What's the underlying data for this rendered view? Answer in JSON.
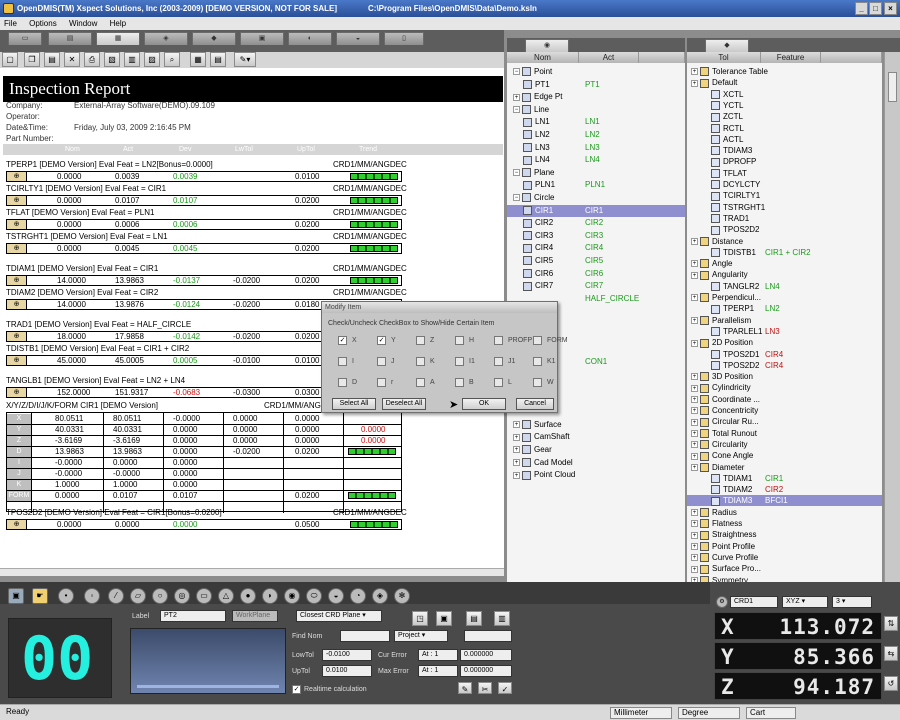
{
  "window": {
    "title": "OpenDMIS(TM) Xspect Solutions, Inc (2003-2009) [DEMO VERSION, NOT FOR SALE]",
    "path": "C:\\Program Files\\OpenDMIS\\Data\\Demo.ksln"
  },
  "menu": [
    "File",
    "Options",
    "Window",
    "Help"
  ],
  "report": {
    "title": "Inspection Report",
    "meta": [
      {
        "label": "Company:",
        "value": "External-Array Software(DEMO).09.109"
      },
      {
        "label": "Operator:",
        "value": ""
      },
      {
        "label": "Date&Time:",
        "value": "Friday, July 03, 2009 2:16:45 PM"
      },
      {
        "label": "Part Number:",
        "value": ""
      }
    ],
    "columns": [
      "Nom",
      "Act",
      "Dev",
      "LwTol",
      "UpTol",
      "Trend"
    ],
    "features": [
      {
        "header": "TPERP1    [DEMO Version]   Eval Feat = LN2[Bonus=0.0000]",
        "unit": "CRD1/MM/ANGDEC",
        "nom": "0.0000",
        "act": "0.0039",
        "dev": "0.0039",
        "lw": "",
        "up": "0.0100",
        "devc": "green"
      },
      {
        "header": "TCIRLTY1    [DEMO Version]   Eval Feat = CIR1",
        "unit": "CRD1/MM/ANGDEC",
        "nom": "0.0000",
        "act": "0.0107",
        "dev": "0.0107",
        "lw": "",
        "up": "0.0200",
        "devc": "green"
      },
      {
        "header": "TFLAT    [DEMO Version]   Eval Feat = PLN1",
        "unit": "CRD1/MM/ANGDEC",
        "nom": "0.0000",
        "act": "0.0006",
        "dev": "0.0006",
        "lw": "",
        "up": "0.0200",
        "devc": "green"
      },
      {
        "header": "TSTRGHT1    [DEMO Version]   Eval Feat = LN1",
        "unit": "CRD1/MM/ANGDEC",
        "nom": "0.0000",
        "act": "0.0045",
        "dev": "0.0045",
        "lw": "",
        "up": "0.0200",
        "devc": "green"
      },
      {
        "header": "TDIAM1    [DEMO Version]   Eval Feat = CIR1",
        "unit": "CRD1/MM/ANGDEC",
        "nom": "14.0000",
        "act": "13.9863",
        "dev": "-0.0137",
        "lw": "-0.0200",
        "up": "0.0200",
        "devc": "green"
      },
      {
        "header": "TDIAM2    [DEMO Version]   Eval Feat = CIR2",
        "unit": "CRD1/MM/ANGDEC",
        "nom": "14.0000",
        "act": "13.9876",
        "dev": "-0.0124",
        "lw": "-0.0200",
        "up": "0.0180",
        "devc": "green"
      },
      {
        "header": "TRAD1    [DEMO Version]   Eval Feat = HALF_CIRCLE",
        "unit": "",
        "nom": "18.0000",
        "act": "17.9858",
        "dev": "-0.0142",
        "lw": "-0.0200",
        "up": "0.0200",
        "devc": "green"
      },
      {
        "header": "TDISTB1    [DEMO Version]   Eval Feat = CIR1 + CIR2",
        "unit": "",
        "nom": "45.0000",
        "act": "45.0005",
        "dev": "0.0005",
        "lw": "-0.0100",
        "up": "0.0100",
        "devc": "green"
      },
      {
        "header": "TANGLB1    [DEMO Version]   Eval Feat = LN2 + LN4",
        "unit": "",
        "nom": "152.0000",
        "act": "151.9317",
        "dev": "-0.0683",
        "lw": "-0.0300",
        "up": "0.0300",
        "devc": "red"
      }
    ],
    "xyz_block": {
      "header": "X/Y/Z/D/I/J/K/FORM    CIR1    [DEMO Version]",
      "unit": "CRD1/MM/ANG",
      "rows": [
        {
          "lbl": "X",
          "nom": "80.0511",
          "act": "80.0511",
          "dev": "-0.0000",
          "lw": "0.0000",
          "up": "0.0000",
          "bar": false,
          "tr": ""
        },
        {
          "lbl": "Y",
          "nom": "40.0331",
          "act": "40.0331",
          "dev": "0.0000",
          "lw": "0.0000",
          "up": "0.0000",
          "bar": false,
          "tr": "0.0000"
        },
        {
          "lbl": "Z",
          "nom": "-3.6169",
          "act": "-3.6169",
          "dev": "0.0000",
          "lw": "0.0000",
          "up": "0.0000",
          "bar": false,
          "tr": "0.0000"
        },
        {
          "lbl": "D",
          "nom": "13.9863",
          "act": "13.9863",
          "dev": "0.0000",
          "lw": "-0.0200",
          "up": "0.0200",
          "bar": true,
          "tr": ""
        },
        {
          "lbl": "I",
          "nom": "-0.0000",
          "act": "0.0000",
          "dev": "0.0000",
          "lw": "",
          "up": "",
          "bar": false,
          "tr": ""
        },
        {
          "lbl": "J",
          "nom": "-0.0000",
          "act": "-0.0000",
          "dev": "0.0000",
          "lw": "",
          "up": "",
          "bar": false,
          "tr": ""
        },
        {
          "lbl": "K",
          "nom": "1.0000",
          "act": "1.0000",
          "dev": "0.0000",
          "lw": "",
          "up": "",
          "bar": false,
          "tr": ""
        },
        {
          "lbl": "FORM",
          "nom": "0.0000",
          "act": "0.0107",
          "dev": "0.0107",
          "lw": "",
          "up": "0.0200",
          "bar": true,
          "tr": ""
        }
      ]
    },
    "last_feature": {
      "header": "TPOS2D2    [DEMO Version]   Eval Feat = CIR1[Bonus=0.0200]",
      "unit": "CRD1/MM/ANGDEC",
      "nom": "0.0000",
      "act": "0.0000",
      "dev": "0.0000",
      "lw": "",
      "up": "0.0500",
      "devc": "green"
    }
  },
  "feature_tree": {
    "columns": [
      "Nom",
      "Act"
    ],
    "items": [
      {
        "t": "Point",
        "a": "",
        "lvl": 0,
        "g": 1
      },
      {
        "t": "PT1",
        "a": "PT1",
        "lvl": 1
      },
      {
        "t": "Edge Pt",
        "a": "",
        "lvl": 0
      },
      {
        "t": "Line",
        "a": "",
        "lvl": 0,
        "g": 1
      },
      {
        "t": "LN1",
        "a": "LN1",
        "lvl": 1
      },
      {
        "t": "LN2",
        "a": "LN2",
        "lvl": 1
      },
      {
        "t": "LN3",
        "a": "LN3",
        "lvl": 1
      },
      {
        "t": "LN4",
        "a": "LN4",
        "lvl": 1
      },
      {
        "t": "Plane",
        "a": "",
        "lvl": 0,
        "g": 1
      },
      {
        "t": "PLN1",
        "a": "PLN1",
        "lvl": 1
      },
      {
        "t": "Circle",
        "a": "",
        "lvl": 0,
        "g": 1
      },
      {
        "t": "CIR1",
        "a": "CIR1",
        "lvl": 1,
        "sel": true
      },
      {
        "t": "CIR2",
        "a": "CIR2",
        "lvl": 1
      },
      {
        "t": "CIR3",
        "a": "CIR3",
        "lvl": 1
      },
      {
        "t": "CIR4",
        "a": "CIR4",
        "lvl": 1
      },
      {
        "t": "CIR5",
        "a": "CIR5",
        "lvl": 1
      },
      {
        "t": "CIR6",
        "a": "CIR6",
        "lvl": 1
      },
      {
        "t": "CIR7",
        "a": "CIR7",
        "lvl": 1
      },
      {
        "t": "",
        "a": "HALF_CIRCLE",
        "lvl": 1
      },
      {
        "t": "",
        "a": "",
        "lvl": 1
      },
      {
        "t": "",
        "a": "",
        "lvl": 1
      },
      {
        "t": "",
        "a": "",
        "lvl": 1
      },
      {
        "t": "",
        "a": "",
        "lvl": 1
      },
      {
        "t": "",
        "a": "CON1",
        "lvl": 1
      },
      {
        "t": "",
        "a": "",
        "lvl": 1
      },
      {
        "t": "",
        "a": "",
        "lvl": 1
      },
      {
        "t": "",
        "a": "",
        "lvl": 1
      },
      {
        "t": "",
        "a": "",
        "lvl": 1
      },
      {
        "t": "Surface",
        "a": "",
        "lvl": 0
      },
      {
        "t": "CamShaft",
        "a": "",
        "lvl": 0
      },
      {
        "t": "Gear",
        "a": "",
        "lvl": 0
      },
      {
        "t": "Cad Model",
        "a": "",
        "lvl": 0
      },
      {
        "t": "Point Cloud",
        "a": "",
        "lvl": 0
      }
    ]
  },
  "tol_tree": {
    "columns": [
      "Tol",
      "Feature"
    ],
    "items": [
      {
        "t": "Tolerance Table",
        "f": "",
        "lvl": 0
      },
      {
        "t": "Default",
        "f": "",
        "lvl": 0
      },
      {
        "t": "XCTL",
        "f": "",
        "lvl": 1
      },
      {
        "t": "YCTL",
        "f": "",
        "lvl": 1
      },
      {
        "t": "ZCTL",
        "f": "",
        "lvl": 1
      },
      {
        "t": "RCTL",
        "f": "",
        "lvl": 1
      },
      {
        "t": "ACTL",
        "f": "",
        "lvl": 1
      },
      {
        "t": "TDIAM3",
        "f": "",
        "lvl": 1
      },
      {
        "t": "DPROFP",
        "f": "",
        "lvl": 1
      },
      {
        "t": "TFLAT",
        "f": "",
        "lvl": 1
      },
      {
        "t": "DCYLCTY",
        "f": "",
        "lvl": 1
      },
      {
        "t": "TCIRLTY1",
        "f": "",
        "lvl": 1
      },
      {
        "t": "TSTRGHT1",
        "f": "",
        "lvl": 1
      },
      {
        "t": "TRAD1",
        "f": "",
        "lvl": 1
      },
      {
        "t": "TPOS2D2",
        "f": "",
        "lvl": 1
      },
      {
        "t": "Distance",
        "f": "",
        "lvl": 0
      },
      {
        "t": "TDISTB1",
        "f": "CIR1 + CIR2",
        "lvl": 1
      },
      {
        "t": "Angle",
        "f": "",
        "lvl": 0
      },
      {
        "t": "Angularity",
        "f": "",
        "lvl": 0
      },
      {
        "t": "TANGLR2",
        "f": "LN4",
        "lvl": 1
      },
      {
        "t": "Perpendicul...",
        "f": "",
        "lvl": 0
      },
      {
        "t": "TPERP1",
        "f": "LN2",
        "lvl": 1
      },
      {
        "t": "Parallelism",
        "f": "",
        "lvl": 0
      },
      {
        "t": "TPARLEL1",
        "f": "LN3",
        "lvl": 1,
        "fr": 1
      },
      {
        "t": "2D Position",
        "f": "",
        "lvl": 0
      },
      {
        "t": "TPOS2D1",
        "f": "CIR4",
        "lvl": 1,
        "fr": 1
      },
      {
        "t": "TPOS2D2",
        "f": "CIR4",
        "lvl": 1,
        "fr": 1
      },
      {
        "t": "3D Position",
        "f": "",
        "lvl": 0
      },
      {
        "t": "Cylindricity",
        "f": "",
        "lvl": 0
      },
      {
        "t": "Coordinate ...",
        "f": "",
        "lvl": 0
      },
      {
        "t": "Concentricity",
        "f": "",
        "lvl": 0
      },
      {
        "t": "Circular Ru...",
        "f": "",
        "lvl": 0
      },
      {
        "t": "Total Runout",
        "f": "",
        "lvl": 0
      },
      {
        "t": "Circularity",
        "f": "",
        "lvl": 0
      },
      {
        "t": "Cone Angle",
        "f": "",
        "lvl": 0
      },
      {
        "t": "Diameter",
        "f": "",
        "lvl": 0
      },
      {
        "t": "TDIAM1",
        "f": "CIR1",
        "lvl": 1
      },
      {
        "t": "TDIAM2",
        "f": "CIR2",
        "lvl": 1,
        "fr": 1
      },
      {
        "t": "TDIAM3",
        "f": "BFCI1",
        "lvl": 1,
        "sel": true
      },
      {
        "t": "Radius",
        "f": "",
        "lvl": 0
      },
      {
        "t": "Flatness",
        "f": "",
        "lvl": 0
      },
      {
        "t": "Straightness",
        "f": "",
        "lvl": 0
      },
      {
        "t": "Point Profile",
        "f": "",
        "lvl": 0
      },
      {
        "t": "Curve Profile",
        "f": "",
        "lvl": 0
      },
      {
        "t": "Surface Pro...",
        "f": "",
        "lvl": 0
      },
      {
        "t": "Symmetry",
        "f": "",
        "lvl": 0
      }
    ]
  },
  "dialog": {
    "title": "Modify Item",
    "message": "Check/Uncheck CheckBox to Show/Hide Certain Item",
    "checks": [
      {
        "l": "X",
        "c": true
      },
      {
        "l": "Y",
        "c": true
      },
      {
        "l": "Z",
        "c": false
      },
      {
        "l": "H",
        "c": false
      },
      {
        "l": "PROFP",
        "c": false
      },
      {
        "l": "FORM",
        "c": false
      },
      {
        "l": "I",
        "c": false
      },
      {
        "l": "J",
        "c": false
      },
      {
        "l": "K",
        "c": false
      },
      {
        "l": "I1",
        "c": false
      },
      {
        "l": "J1",
        "c": false
      },
      {
        "l": "K1",
        "c": false
      },
      {
        "l": "D",
        "c": false
      },
      {
        "l": "r",
        "c": false
      },
      {
        "l": "A",
        "c": false
      },
      {
        "l": "B",
        "c": false
      },
      {
        "l": "L",
        "c": false
      },
      {
        "l": "W",
        "c": false
      }
    ],
    "buttons": {
      "select_all": "Select All",
      "deselect_all": "Deselect All",
      "ok": "OK",
      "cancel": "Cancel"
    }
  },
  "bottom": {
    "counter": "00",
    "label_caption": "Label",
    "label_value": "PT2",
    "workplane": "WorkPlane",
    "crd_plane": "Closest CRD Plane",
    "find_nom": "Find Nom",
    "project": "Project",
    "lowtol_label": "LowTol",
    "lowtol": "-0.0100",
    "uptol_label": "UpTol",
    "uptol": "0.0100",
    "cur_error": "Cur Error",
    "max_error": "Max Error",
    "at1": "At : 1",
    "at2": "At : 1",
    "err1": "0.000000",
    "err2": "0.000000",
    "realtime": "Realtime calculation",
    "crd": "CRD1",
    "xyz": "XYZ",
    "num": "3",
    "dro": [
      {
        "ax": "X",
        "v": "113.072"
      },
      {
        "ax": "Y",
        "v": "85.366"
      },
      {
        "ax": "Z",
        "v": "94.187"
      }
    ]
  },
  "status": {
    "ready": "Ready",
    "unit": "Millimeter",
    "angle": "Degree",
    "coord": "Cart"
  }
}
